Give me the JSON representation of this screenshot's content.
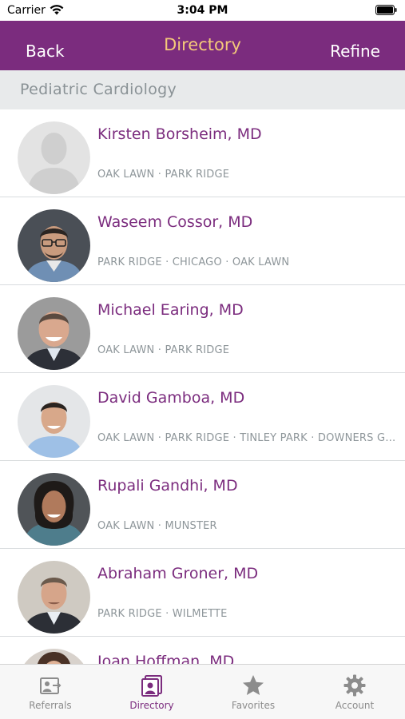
{
  "status_bar": {
    "carrier": "Carrier",
    "time": "3:04 PM"
  },
  "nav": {
    "back_label": "Back",
    "title": "Directory",
    "refine_label": "Refine"
  },
  "section": {
    "title": "Pediatric Cardiology"
  },
  "providers": [
    {
      "name": "Kirsten Borsheim, MD",
      "locations": "OAK LAWN · PARK RIDGE"
    },
    {
      "name": "Waseem Cossor, MD",
      "locations": "PARK RIDGE · CHICAGO · OAK LAWN"
    },
    {
      "name": "Michael Earing, MD",
      "locations": "OAK LAWN · PARK RIDGE"
    },
    {
      "name": "David Gamboa, MD",
      "locations": "OAK LAWN · PARK RIDGE · TINLEY PARK · DOWNERS GROVE"
    },
    {
      "name": "Rupali Gandhi, MD",
      "locations": "OAK LAWN · MUNSTER"
    },
    {
      "name": "Abraham Groner, MD",
      "locations": "PARK RIDGE · WILMETTE"
    },
    {
      "name": "Joan Hoffman, MD",
      "locations": ""
    }
  ],
  "tabs": [
    {
      "label": "Referrals",
      "icon": "referral-icon",
      "active": false
    },
    {
      "label": "Directory",
      "icon": "directory-icon",
      "active": true
    },
    {
      "label": "Favorites",
      "icon": "star-icon",
      "active": false
    },
    {
      "label": "Account",
      "icon": "gear-icon",
      "active": false
    }
  ],
  "colors": {
    "brand_purple": "#7b2c7e",
    "title_gold": "#f4c97a",
    "section_bg": "#e8eaeb",
    "muted_text": "#8e969a"
  }
}
